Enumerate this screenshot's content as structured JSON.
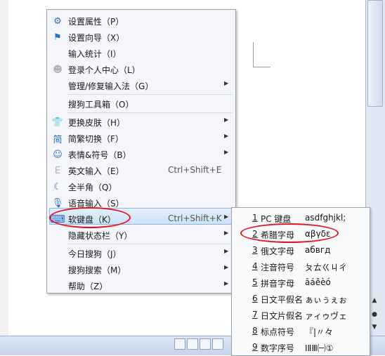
{
  "menu": {
    "items": [
      {
        "label": "设置属性（P）",
        "icon": "gear-icon",
        "glyph": "⚙",
        "shortcut": "",
        "arrow": false,
        "sep_before": false,
        "disabled_icon": false
      },
      {
        "label": "设置向导（X）",
        "icon": "flag-icon",
        "glyph": "⚑",
        "shortcut": "",
        "arrow": false,
        "sep_before": false,
        "disabled_icon": false
      },
      {
        "label": "输入统计（I）",
        "icon": "",
        "glyph": "",
        "shortcut": "",
        "arrow": false,
        "sep_before": false,
        "disabled_icon": false
      },
      {
        "label": "登录个人中心（L）",
        "icon": "user-icon",
        "glyph": "☻",
        "shortcut": "",
        "arrow": false,
        "sep_before": false,
        "disabled_icon": true
      },
      {
        "label": "管理/修复输入法（G）",
        "icon": "",
        "glyph": "",
        "shortcut": "",
        "arrow": true,
        "sep_before": false,
        "disabled_icon": false
      },
      {
        "label": "搜狗工具箱（O）",
        "icon": "",
        "glyph": "",
        "shortcut": "",
        "arrow": false,
        "sep_before": true,
        "disabled_icon": false
      },
      {
        "label": "更换皮肤（H）",
        "icon": "shirt-icon",
        "glyph": "👕",
        "shortcut": "",
        "arrow": true,
        "sep_before": true,
        "disabled_icon": false
      },
      {
        "label": "简繁切换（F）",
        "icon": "simplified-traditional-icon",
        "glyph": "简",
        "shortcut": "",
        "arrow": true,
        "sep_before": false,
        "disabled_icon": false
      },
      {
        "label": "表情&符号（B）",
        "icon": "smiley-icon",
        "glyph": "☺",
        "shortcut": "",
        "arrow": true,
        "sep_before": false,
        "disabled_icon": false
      },
      {
        "label": "英文输入（E）",
        "icon": "english-e-icon",
        "glyph": "E",
        "shortcut": "Ctrl+Shift+E",
        "arrow": false,
        "sep_before": false,
        "disabled_icon": true
      },
      {
        "label": "全半角（Q）",
        "icon": "moon-icon",
        "glyph": "☾",
        "shortcut": "",
        "arrow": false,
        "sep_before": false,
        "disabled_icon": false
      },
      {
        "label": "语音输入（S）",
        "icon": "microphone-icon",
        "glyph": "🎙",
        "shortcut": "",
        "arrow": false,
        "sep_before": false,
        "disabled_icon": false
      },
      {
        "label": "软键盘（K）",
        "icon": "keyboard-icon",
        "glyph": "⌨",
        "shortcut": "Ctrl+Shift+K",
        "arrow": true,
        "sep_before": false,
        "disabled_icon": false
      },
      {
        "label": "隐藏状态栏（Y）",
        "icon": "",
        "glyph": "",
        "shortcut": "",
        "arrow": true,
        "sep_before": false,
        "disabled_icon": false
      },
      {
        "label": "今日搜狗（J）",
        "icon": "",
        "glyph": "",
        "shortcut": "",
        "arrow": true,
        "sep_before": true,
        "disabled_icon": false
      },
      {
        "label": "搜狗搜索（M）",
        "icon": "",
        "glyph": "",
        "shortcut": "",
        "arrow": true,
        "sep_before": false,
        "disabled_icon": false
      },
      {
        "label": "帮助（Z）",
        "icon": "",
        "glyph": "",
        "shortcut": "",
        "arrow": true,
        "sep_before": false,
        "disabled_icon": false
      }
    ],
    "highlighted_index": 12
  },
  "submenu": {
    "items": [
      {
        "num": "1",
        "name": "PC 键盘",
        "preview": "asdfghjkl;"
      },
      {
        "num": "2",
        "name": "希腊字母",
        "preview": "αβγδε"
      },
      {
        "num": "3",
        "name": "俄文字母",
        "preview": "абвгд"
      },
      {
        "num": "4",
        "name": "注音符号",
        "preview": "ㄆㄊㄍㄐㄔ"
      },
      {
        "num": "5",
        "name": "拼音字母",
        "preview": "āáěèó"
      },
      {
        "num": "6",
        "name": "日文平假名",
        "preview": "ぁぃぅぇぉ"
      },
      {
        "num": "7",
        "name": "日文片假名",
        "preview": "ァィゥヴェ"
      },
      {
        "num": "8",
        "name": "标点符号",
        "preview": "『|〃々"
      },
      {
        "num": "9",
        "name": "数字序号",
        "preview": "ⅠⅡⅢ㈠①"
      }
    ]
  },
  "colors": {
    "accent": "#2d6fc4",
    "annotation": "#e0141e",
    "highlight": "#cde2f7"
  }
}
